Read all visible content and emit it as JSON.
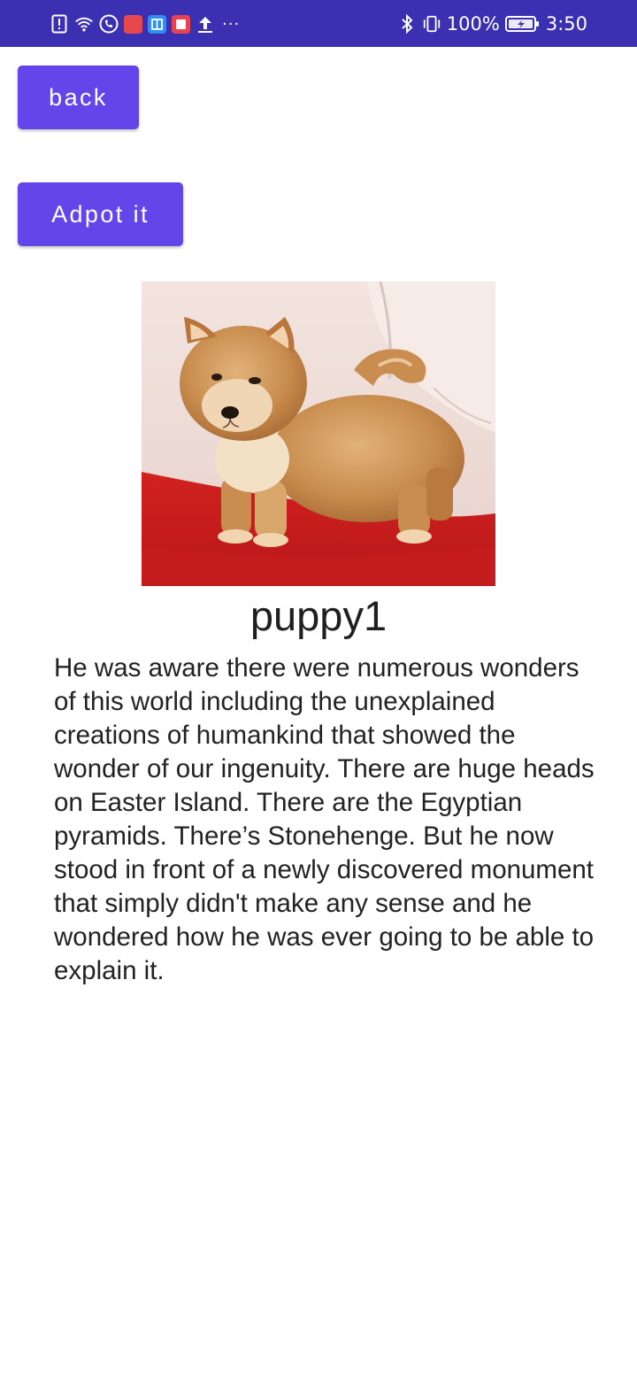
{
  "status_bar": {
    "battery_percent": "100%",
    "time": "3:50",
    "overflow_dots": "···",
    "left_icons": [
      "alert-icon",
      "wifi-icon",
      "phone-icon",
      "app-tile-icon",
      "app-tile-icon",
      "app-tile-icon",
      "upload-icon"
    ],
    "right_icons": [
      "bluetooth-icon",
      "vibrate-icon",
      "battery-icon"
    ],
    "colors": {
      "background": "#3b2fb2",
      "tile_red": "#e5484d",
      "tile_blue": "#2f8ff0",
      "tile_pink": "#e8444f"
    }
  },
  "actions": {
    "back_label": "back",
    "adopt_label": "Adpot it",
    "button_color": "#6246ea"
  },
  "pet": {
    "name": "puppy1",
    "description": "He was aware there were numerous wonders of this world including the unexplained creations of humankind that showed the wonder of our ingenuity. There are huge heads on Easter Island. There are the Egyptian pyramids. There’s Stonehenge. But he now stood in front of a newly discovered monument that simply didn't make any sense and he wondered how he was ever going to be able to explain it."
  }
}
